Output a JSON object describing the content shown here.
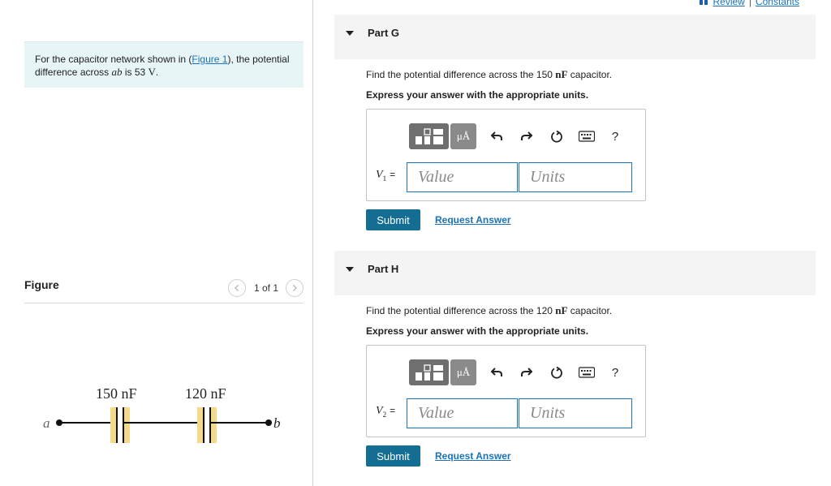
{
  "top_links": {
    "review": "Review",
    "separator": "|",
    "constants": "Constants"
  },
  "problem": {
    "text_before": "For the capacitor network shown in (",
    "figure_link": "Figure 1",
    "text_mid": "), the potential difference across ",
    "var": "ab",
    "text_is": " is 53 ",
    "unit": "V",
    "text_end": "."
  },
  "figure": {
    "title": "Figure",
    "pager": "1 of 1",
    "circuit": {
      "node_a": "a",
      "node_b": "b",
      "cap1_label": "150 nF",
      "cap2_label": "120 nF",
      "plate_color": "#f5d98a"
    }
  },
  "parts": [
    {
      "label": "Part G",
      "question_before": "Find the potential difference across the 150 ",
      "question_unit": "nF",
      "question_after": " capacitor.",
      "instruction": "Express your answer with the appropriate units.",
      "var_symbol": "V",
      "var_sub": "1",
      "var_eq": "=",
      "value_placeholder": "Value",
      "units_placeholder": "Units",
      "submit": "Submit",
      "request": "Request Answer"
    },
    {
      "label": "Part H",
      "question_before": "Find the potential difference across the 120 ",
      "question_unit": "nF",
      "question_after": " capacitor.",
      "instruction": "Express your answer with the appropriate units.",
      "var_symbol": "V",
      "var_sub": "2",
      "var_eq": "=",
      "value_placeholder": "Value",
      "units_placeholder": "Units",
      "submit": "Submit",
      "request": "Request Answer"
    }
  ],
  "toolbar": {
    "units_button": "μÅ",
    "help": "?",
    "icons": [
      "templates-icon",
      "units-icon",
      "undo-icon",
      "redo-icon",
      "reset-icon",
      "keyboard-icon",
      "help-icon"
    ]
  },
  "colors": {
    "accent": "#146e94",
    "link": "#1a73b8",
    "problem_bg": "#e7f5f7",
    "part_header_bg": "#f4f4f4"
  }
}
